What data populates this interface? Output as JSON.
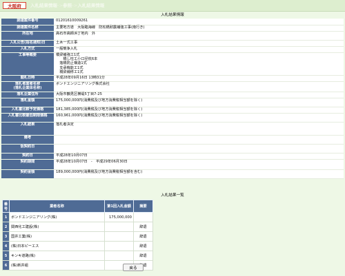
{
  "header": {
    "logo": "大阪府",
    "crumb1": "入札結果情報",
    "arrow1": "->",
    "crumb2": "参照",
    "arrow2": "->",
    "crumb3": "入札結果情報"
  },
  "main_title": "入札結果情報",
  "fields": [
    {
      "label": "調達案件番号",
      "value": "01201610009261"
    },
    {
      "label": "調達案件名称",
      "value": "主要地方道　大阪臨海線　防松橋耐震補強工事(南行き)"
    },
    {
      "label": "所在地",
      "value": "高石市高師浜丁地内　外"
    },
    {
      "label": "入札公告(指名通知)日",
      "value": "土木一式工事"
    },
    {
      "label": "入札方式",
      "value": "一般競争入札"
    },
    {
      "label": "工事等概要",
      "value": "橋梁補強工1式\n　　橋し柱工小口径杭6本\n　落橋防止構造1式\n　支承機能工1式\n　橋梁補修工1式"
    },
    {
      "label": "開札日時",
      "value": "平成28年09月16日 13時31分"
    },
    {
      "label": "落札者業者名称\n(落札企業体名称)",
      "value": "ボンドエンジニアリング株式会社"
    },
    {
      "label": "落札企業住所",
      "value": "大阪市鶴見区横堤5丁目7-25"
    },
    {
      "label": "落札金額",
      "value": "175,000,000円(消費税及び地方消費税相当額を除く)"
    },
    {
      "label": "入札書比較予定価格",
      "value": "181,385,000円(消費税及び地方消費税相当額を除く)"
    },
    {
      "label": "入札書比較最低制限価格",
      "value": "160,961,000円(消費税及び地方消費税相当額を除く)"
    },
    {
      "label": "入札結果",
      "value": "落札者決定"
    },
    {
      "label": "備考",
      "value": ""
    },
    {
      "label": "仮契約日",
      "value": ""
    },
    {
      "label": "契約日",
      "value": "平成28年10月07日"
    },
    {
      "label": "契約期間",
      "value": "平成28年10月07日　-　平成29年06月30日"
    },
    {
      "label": "契約金額",
      "value": "189,000,000円(消費税及び地方消費税相当額を含む)"
    }
  ],
  "list_title": "入札結果一覧",
  "list_headers": {
    "no": "番号",
    "name": "業者名称",
    "amount": "第1回入札金額",
    "remarks": "摘要"
  },
  "bidders": [
    {
      "no": "1",
      "name": "ボンドエンジニアリング(株)",
      "amount": "175,000,000",
      "remarks": ""
    },
    {
      "no": "2",
      "name": "関西化工建設(株)",
      "amount": "",
      "remarks": "辞退"
    },
    {
      "no": "3",
      "name": "国井工業(株)",
      "amount": "",
      "remarks": "辞退"
    },
    {
      "no": "4",
      "name": "(株)日本ピーエス",
      "amount": "",
      "remarks": "辞退"
    },
    {
      "no": "5",
      "name": "キンキ道路(株)",
      "amount": "",
      "remarks": "辞退"
    },
    {
      "no": "6",
      "name": "(株)新井組",
      "amount": "",
      "remarks": "辞退"
    }
  ],
  "back_button": "戻る"
}
